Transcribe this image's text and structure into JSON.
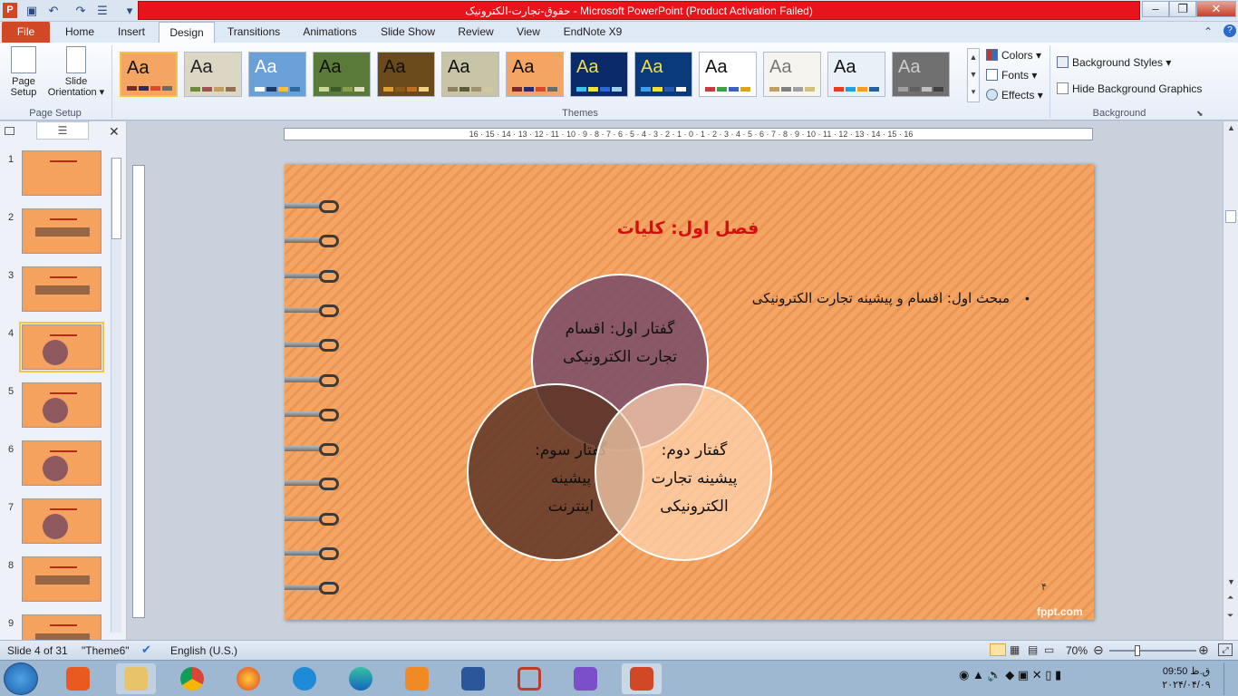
{
  "window": {
    "title": "حقوق-تجارت-الکترونیک  -  Microsoft PowerPoint (Product Activation Failed)",
    "app_letter": "P"
  },
  "tabs": [
    {
      "label": "File"
    },
    {
      "label": "Home"
    },
    {
      "label": "Insert"
    },
    {
      "label": "Design"
    },
    {
      "label": "Transitions"
    },
    {
      "label": "Animations"
    },
    {
      "label": "Slide Show"
    },
    {
      "label": "Review"
    },
    {
      "label": "View"
    },
    {
      "label": "EndNote X9"
    }
  ],
  "ribbon": {
    "page_setup": {
      "btn1": "Page\nSetup",
      "btn1_a": "Page",
      "btn1_b": "Setup",
      "btn2_a": "Slide",
      "btn2_b": "Orientation ▾",
      "label": "Page Setup"
    },
    "themes": {
      "label": "Themes",
      "items": [
        {
          "aa": "Aa",
          "bg": "#f4a563",
          "fg": "#111111",
          "sw": [
            "#7a2a2a",
            "#2a2a6a",
            "#d94a2a",
            "#6a6a6a"
          ],
          "name": "theme-orange-current"
        },
        {
          "aa": "Aa",
          "bg": "#dcd6c4",
          "fg": "#222222",
          "sw": [
            "#6b8a3a",
            "#a05050",
            "#c0a060",
            "#907050"
          ],
          "name": "theme-photo-collage"
        },
        {
          "aa": "Aa",
          "bg": "#6aa0d8",
          "fg": "#ffffff",
          "sw": [
            "#ffffff",
            "#1a3a6a",
            "#f0c040",
            "#2a6aa0"
          ],
          "name": "theme-blue-sky"
        },
        {
          "aa": "Aa",
          "bg": "#5a7a3a",
          "fg": "#111111",
          "sw": [
            "#c8d898",
            "#3a5a2a",
            "#8aa050",
            "#e0e0c0"
          ],
          "name": "theme-green-forest"
        },
        {
          "aa": "Aa",
          "bg": "#6a4a1a",
          "fg": "#111111",
          "sw": [
            "#e0a030",
            "#8a5a1a",
            "#c07020",
            "#f0d080"
          ],
          "name": "theme-autumn"
        },
        {
          "aa": "Aa",
          "bg": "#c8c4a8",
          "fg": "#111111",
          "sw": [
            "#8a8060",
            "#5a5a3a",
            "#a09070",
            "#d0c8a0"
          ],
          "name": "theme-pebbles"
        },
        {
          "aa": "Aa",
          "bg": "#f4a563",
          "fg": "#111111",
          "sw": [
            "#7a2a2a",
            "#2a2a6a",
            "#d94a2a",
            "#6a6a6a"
          ],
          "name": "theme-orange-alt"
        },
        {
          "aa": "Aa",
          "bg": "#0a2a6a",
          "fg": "#f0e040",
          "sw": [
            "#40c0f0",
            "#f0e040",
            "#2a6ad0",
            "#a0d0f0"
          ],
          "name": "theme-dark-blue"
        },
        {
          "aa": "Aa",
          "bg": "#0a3a7a",
          "fg": "#f0e040",
          "sw": [
            "#40a0f0",
            "#f0e040",
            "#2a5ab0",
            "#ffffff"
          ],
          "name": "theme-blue-wave"
        },
        {
          "aa": "Aa",
          "bg": "#ffffff",
          "fg": "#111111",
          "sw": [
            "#c04040",
            "#40a040",
            "#4060c0",
            "#e0a020"
          ],
          "name": "theme-white"
        },
        {
          "aa": "Aa",
          "bg": "#f6f4ee",
          "fg": "#777777",
          "sw": [
            "#c0a060",
            "#808080",
            "#a0a0a0",
            "#d0c080"
          ],
          "name": "theme-paper"
        },
        {
          "aa": "Aa",
          "bg": "#e8f0f8",
          "fg": "#111111",
          "sw": [
            "#e04020",
            "#20a0e0",
            "#f0a020",
            "#2060a0"
          ],
          "name": "theme-angles"
        },
        {
          "aa": "Aa",
          "bg": "#707070",
          "fg": "#cccccc",
          "sw": [
            "#a0a0a0",
            "#606060",
            "#c0c0c0",
            "#404040"
          ],
          "name": "theme-gray"
        }
      ]
    },
    "colors": "Colors ▾",
    "fonts": "Fonts ▾",
    "effects": "Effects ▾",
    "background_styles": "Background Styles ▾",
    "hide_bg": "Hide Background Graphics",
    "background_label": "Background"
  },
  "slides": [
    {
      "num": "1"
    },
    {
      "num": "2"
    },
    {
      "num": "3"
    },
    {
      "num": "4"
    },
    {
      "num": "5"
    },
    {
      "num": "6"
    },
    {
      "num": "7"
    },
    {
      "num": "8"
    },
    {
      "num": "9"
    }
  ],
  "ruler": {
    "h": "16 · 15 · 14 · 13 · 12 · 11 · 10 · 9 · 8 · 7 · 6 · 5 · 4 · 3 · 2 · 1 · 0 · 1 · 2 · 3 · 4 · 5 · 6 · 7 · 8 · 9 · 10 · 11 · 12 · 13 · 14 · 15 · 16"
  },
  "slide": {
    "title": "فصل اول: کلیات",
    "bullet": "مبحث اول: اقسام و پیشینه تجارت الکترونیکی",
    "bullet_dot": "•",
    "circle_top": [
      "گفتار اول: اقسام",
      "تجارت الکترونیکی"
    ],
    "circle_right": [
      "گفتار دوم:",
      "پیشینه تجارت",
      "الکترونیکی"
    ],
    "circle_left": [
      "گفتار سوم:",
      "پیشینه",
      "اینترنت"
    ],
    "number": "۴",
    "brand": "fppt.com"
  },
  "status": {
    "slide_of": "Slide 4 of 31",
    "theme": "\"Theme6\"",
    "language": "English (U.S.)",
    "zoom": "70%"
  },
  "tray": {
    "time": "09:50 ق.ظ",
    "date": "۲۰۲۴/۰۴/۰۹"
  }
}
